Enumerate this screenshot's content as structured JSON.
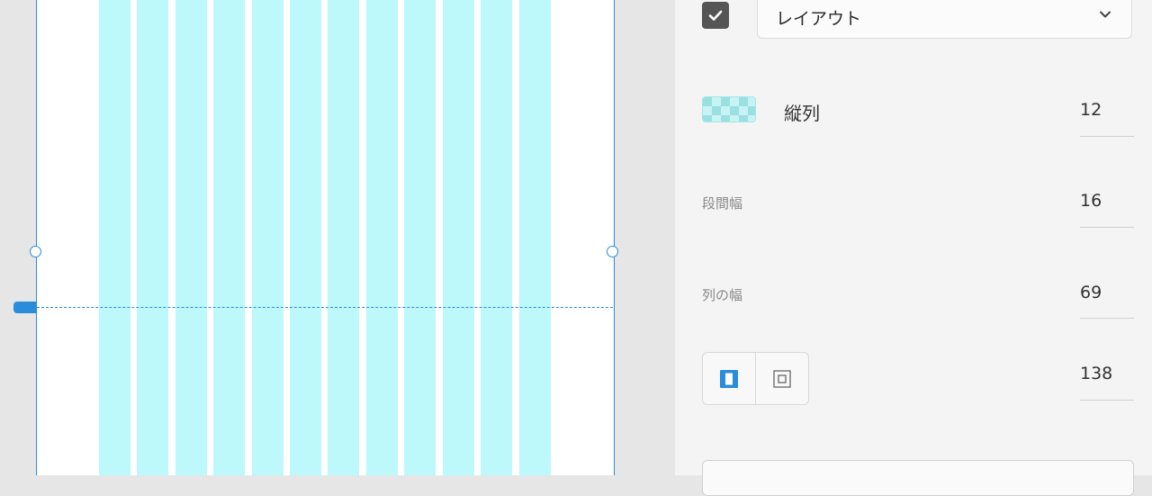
{
  "colors": {
    "accent": "#2a8ddc",
    "column_fill": "#bdf9fb",
    "panel_bg": "#f4f4f4",
    "canvas_bg": "#e6e6e6"
  },
  "panel": {
    "layout_grid": {
      "checkbox_checked": true,
      "dropdown_value": "レイアウト",
      "dropdown_icon": "chevron-down-icon"
    },
    "columns": {
      "label": "縦列",
      "value": "12"
    },
    "gutter_width": {
      "label": "段間幅",
      "value": "16"
    },
    "column_width": {
      "label": "列の幅",
      "value": "69"
    },
    "margins": {
      "value": "138",
      "modes": [
        "linked-margins-icon",
        "individual-margins-icon"
      ],
      "selected_mode": "linked-margins-icon"
    }
  }
}
